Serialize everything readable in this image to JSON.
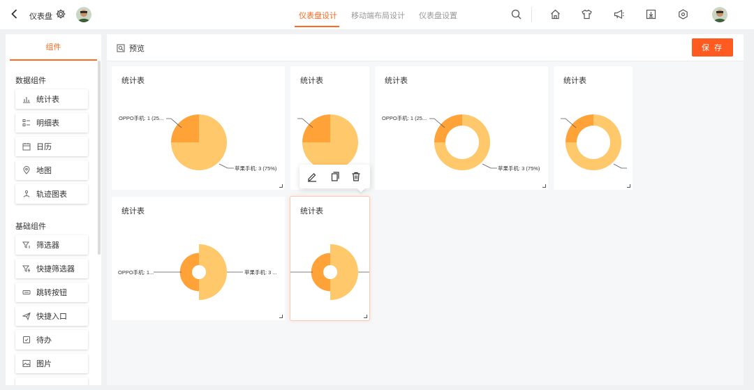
{
  "header": {
    "title": "仪表盘",
    "tabs": [
      {
        "label": "仪表盘设计",
        "active": true
      },
      {
        "label": "移动端布局设计",
        "active": false
      },
      {
        "label": "仪表盘设置",
        "active": false
      }
    ],
    "tool_icons": [
      "search-icon",
      "home-icon",
      "shirt-icon",
      "megaphone-icon",
      "download-icon",
      "hexagon-settings-icon"
    ]
  },
  "sidebar": {
    "tab_label": "组件",
    "data_group": {
      "title": "数据组件",
      "items": [
        {
          "label": "统计表",
          "icon": "bar-chart-icon"
        },
        {
          "label": "明细表",
          "icon": "detail-list-icon"
        },
        {
          "label": "日历",
          "icon": "calendar-icon"
        },
        {
          "label": "地图",
          "icon": "map-pin-icon"
        },
        {
          "label": "轨迹图表",
          "icon": "track-icon"
        }
      ]
    },
    "basic_group": {
      "title": "基础组件",
      "items": [
        {
          "label": "筛选器",
          "icon": "filter-icon"
        },
        {
          "label": "快捷筛选器",
          "icon": "quick-filter-icon"
        },
        {
          "label": "跳转按钮",
          "icon": "jump-button-icon"
        },
        {
          "label": "快捷入口",
          "icon": "send-icon"
        },
        {
          "label": "待办",
          "icon": "todo-icon"
        },
        {
          "label": "图片",
          "icon": "image-icon"
        }
      ]
    }
  },
  "main": {
    "preview_label": "预览",
    "save_label": "保 存",
    "cards": [
      {
        "title": "统计表",
        "chart": "pie",
        "label_left": "OPPO手机: 1 (25...",
        "label_right": "苹果手机: 3 (75%)"
      },
      {
        "title": "统计表",
        "chart": "pie",
        "label_left": "",
        "label_right": ""
      },
      {
        "title": "统计表",
        "chart": "donut",
        "label_left": "OPPO手机: 1 (25...",
        "label_right": "苹果手机: 3 (75%)"
      },
      {
        "title": "统计表",
        "chart": "donut",
        "label_left": "",
        "label_right": ""
      },
      {
        "title": "统计表",
        "chart": "half-rose",
        "label_left": "OPPO手机: 1...",
        "label_right": "苹果手机: 3 ..."
      },
      {
        "title": "统计表",
        "chart": "half-rose",
        "label_left": "",
        "label_right": "",
        "selected": true
      }
    ],
    "card_toolbar": [
      "edit-icon",
      "copy-icon",
      "delete-icon"
    ]
  },
  "chart_data": {
    "type": "pie",
    "categories": [
      "OPPO手机",
      "苹果手机"
    ],
    "values": [
      1,
      3
    ],
    "percents": [
      "25%",
      "75%"
    ],
    "colors": [
      "#ffa238",
      "#ffc86b"
    ]
  }
}
